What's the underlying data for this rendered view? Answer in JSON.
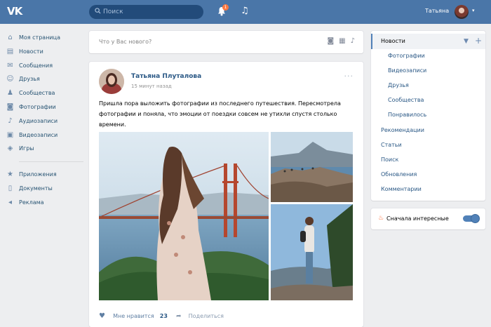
{
  "topbar": {
    "logo": "VK",
    "search_placeholder": "Поиск",
    "notifications_count": "1",
    "user_name": "Татьяна"
  },
  "leftnav": {
    "items": [
      {
        "label": "Моя страница",
        "icon": "home-icon"
      },
      {
        "label": "Новости",
        "icon": "news-icon"
      },
      {
        "label": "Сообщения",
        "icon": "message-icon"
      },
      {
        "label": "Друзья",
        "icon": "friends-icon"
      },
      {
        "label": "Сообщества",
        "icon": "groups-icon"
      },
      {
        "label": "Фотографии",
        "icon": "camera-icon"
      },
      {
        "label": "Аудиозаписи",
        "icon": "music-icon"
      },
      {
        "label": "Видеозаписи",
        "icon": "video-icon"
      },
      {
        "label": "Игры",
        "icon": "gamepad-icon"
      }
    ],
    "secondary": [
      {
        "label": "Приложения",
        "icon": "star-icon"
      },
      {
        "label": "Документы",
        "icon": "document-icon"
      },
      {
        "label": "Реклама",
        "icon": "megaphone-icon"
      }
    ]
  },
  "composer": {
    "placeholder": "Что у Вас нового?"
  },
  "post": {
    "author": "Татьяна Плуталова",
    "time": "15 минут назад",
    "text": "Пришла пора выложить фотографии из последнего путешествия. Пересмотрела фотографии и поняла, что эмоции от поездки совсем не утихли спустя столько времени.",
    "like_label": "Мне нравится",
    "like_count": "23",
    "share_label": "Поделиться"
  },
  "rightmenu": {
    "active": "Новости",
    "subitems": [
      "Фотографии",
      "Видеозаписи",
      "Друзья",
      "Сообщества",
      "Понравилось"
    ],
    "items": [
      "Рекомендации",
      "Статьи",
      "Поиск",
      "Обновления",
      "Комментарии"
    ]
  },
  "sort": {
    "label": "Сначала интересные",
    "enabled": true
  },
  "colors": {
    "header": "#4a76a8",
    "background": "#edeef0",
    "link": "#2a5885",
    "accent": "#5181b8"
  }
}
